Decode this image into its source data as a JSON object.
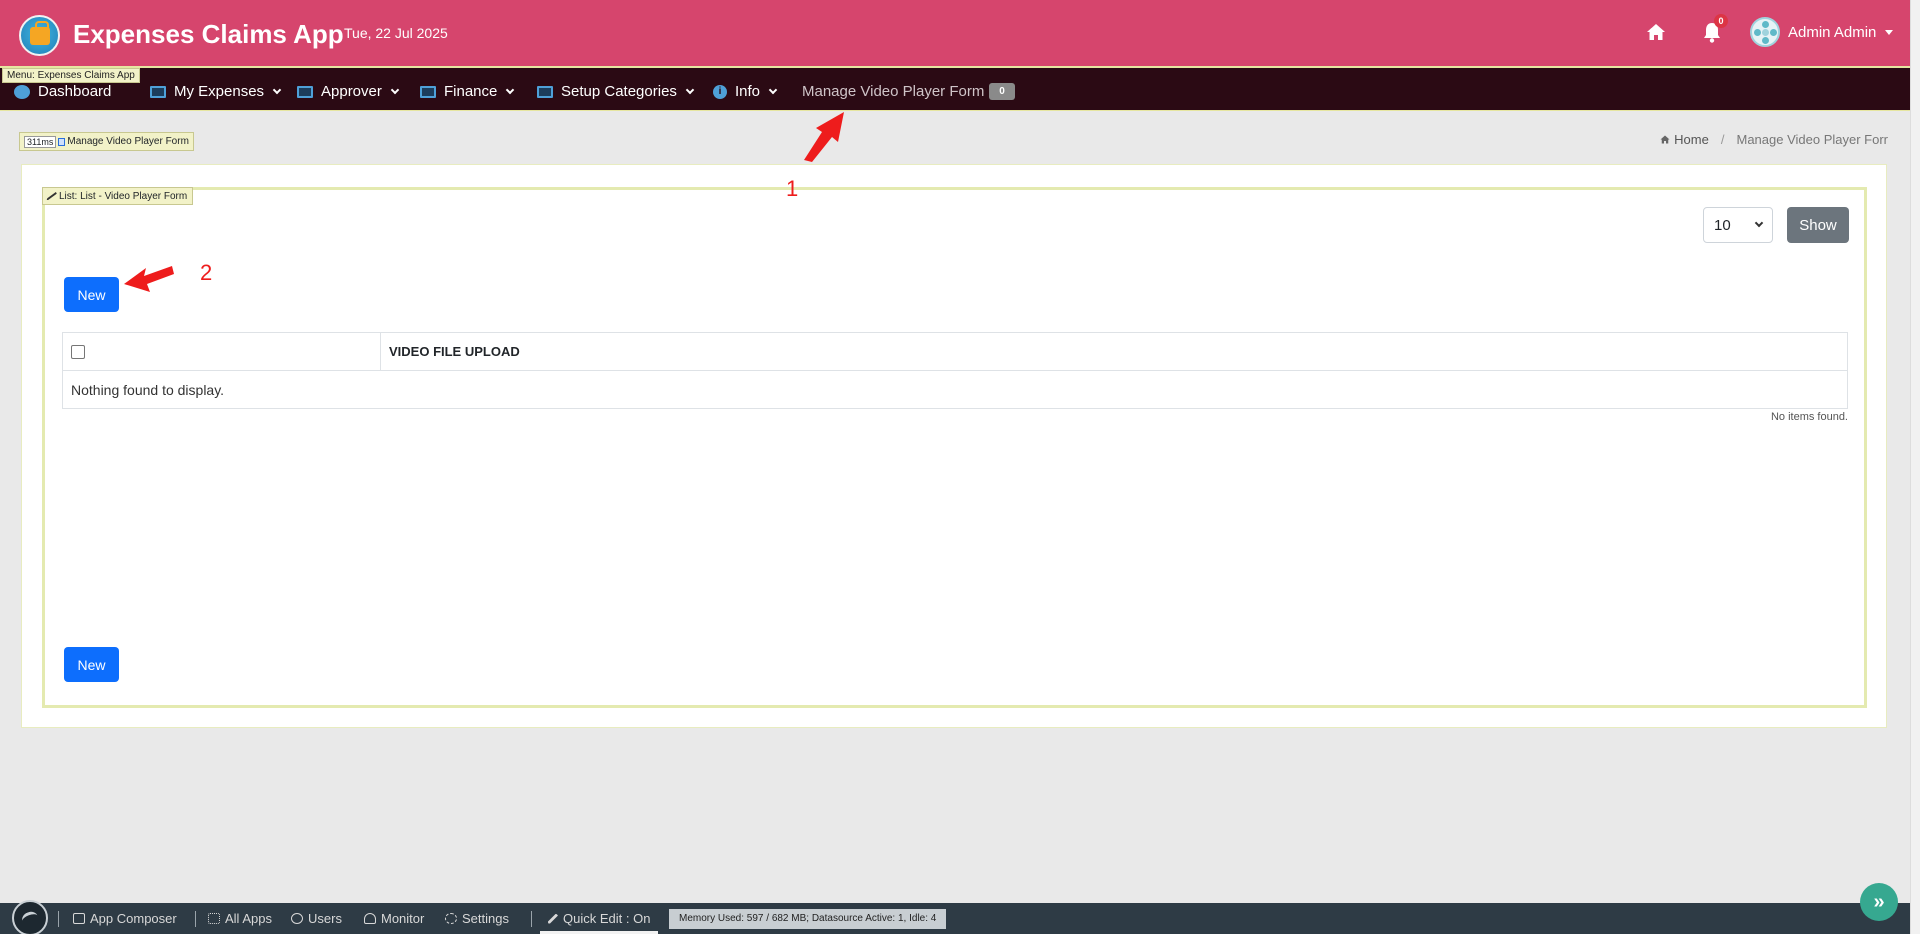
{
  "header": {
    "title": "Expenses Claims App",
    "date": "Tue, 22 Jul 2025",
    "notification_count": "0",
    "user_name": "Admin Admin"
  },
  "navbar": {
    "menu_tag": "Menu: Expenses Claims App",
    "items": [
      {
        "label": "Dashboard",
        "icon": "dashboard-icon"
      },
      {
        "label": "My Expenses",
        "icon": "screen-icon"
      },
      {
        "label": "Approver",
        "icon": "screen-icon"
      },
      {
        "label": "Finance",
        "icon": "screen-icon"
      },
      {
        "label": "Setup Categories",
        "icon": "screen-icon"
      },
      {
        "label": "Info",
        "icon": "info-icon"
      },
      {
        "label": "Manage Video Player Form"
      }
    ],
    "badge": "0"
  },
  "page": {
    "timing": "311ms",
    "timing_label": "Manage Video Player Form",
    "breadcrumb": {
      "home": "Home",
      "current": "Manage Video Player Forr"
    }
  },
  "list": {
    "tag": "List: List - Video Player Form",
    "page_size": "10",
    "show_label": "Show",
    "new_label": "New",
    "columns": [
      "VIDEO FILE UPLOAD"
    ],
    "empty_message": "Nothing found to display.",
    "no_items": "No items found."
  },
  "annotations": {
    "one": "1",
    "two": "2"
  },
  "footer": {
    "app_composer": "App Composer",
    "all_apps": "All Apps",
    "users": "Users",
    "monitor": "Monitor",
    "settings": "Settings",
    "quick_edit": "Quick Edit : On",
    "memory": "Memory Used: 597 / 682 MB; Datasource Active: 1, Idle: 4"
  },
  "colors": {
    "header_bg": "#d6456d",
    "navbar_bg": "#2b0a14",
    "primary": "#0d6efd",
    "secondary": "#6c757d",
    "footer_bg": "#2e3b45",
    "annotation": "#ee1c1c"
  }
}
